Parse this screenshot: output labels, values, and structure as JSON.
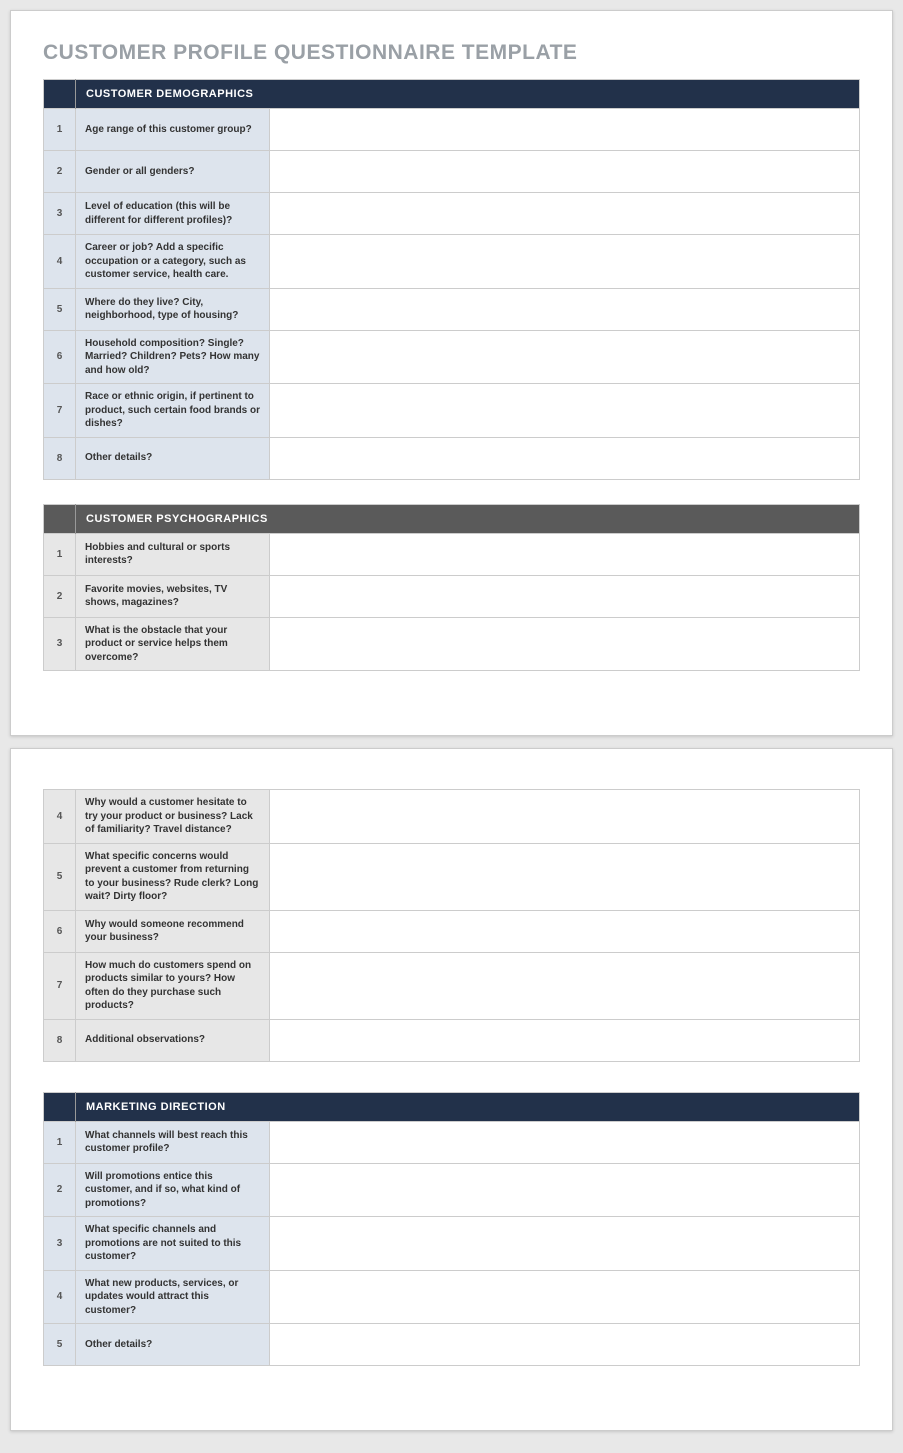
{
  "title": "CUSTOMER PROFILE QUESTIONNAIRE TEMPLATE",
  "sections": {
    "demographics": {
      "header": "CUSTOMER DEMOGRAPHICS",
      "rows": [
        {
          "num": "1",
          "text": "Age range of this customer group?"
        },
        {
          "num": "2",
          "text": "Gender or all genders?"
        },
        {
          "num": "3",
          "text": "Level of education (this will be different for different profiles)?"
        },
        {
          "num": "4",
          "text": "Career or job? Add a specific occupation or a category, such as customer service, health care."
        },
        {
          "num": "5",
          "text": "Where do they live? City, neighborhood, type of housing?"
        },
        {
          "num": "6",
          "text": "Household composition? Single? Married? Children? Pets? How many and how old?"
        },
        {
          "num": "7",
          "text": "Race or ethnic origin, if pertinent to product, such certain food brands or dishes?"
        },
        {
          "num": "8",
          "text": "Other details?"
        }
      ]
    },
    "psychographics": {
      "header": "CUSTOMER PSYCHOGRAPHICS",
      "rows_p1": [
        {
          "num": "1",
          "text": "Hobbies and cultural or sports interests?"
        },
        {
          "num": "2",
          "text": "Favorite movies, websites, TV shows, magazines?"
        },
        {
          "num": "3",
          "text": "What is the obstacle that your product or service helps them overcome?"
        }
      ],
      "rows_p2": [
        {
          "num": "4",
          "text": "Why would a customer hesitate to try your product or business? Lack of familiarity? Travel distance?"
        },
        {
          "num": "5",
          "text": "What specific concerns would prevent a customer from returning to your business? Rude clerk? Long wait? Dirty floor?"
        },
        {
          "num": "6",
          "text": "Why would someone recommend your business?"
        },
        {
          "num": "7",
          "text": "How much do customers spend on products similar to yours? How often do they purchase such products?"
        },
        {
          "num": "8",
          "text": "Additional observations?"
        }
      ]
    },
    "marketing": {
      "header": "MARKETING DIRECTION",
      "rows": [
        {
          "num": "1",
          "text": "What channels will best reach this customer profile?"
        },
        {
          "num": "2",
          "text": "Will promotions entice this customer, and if so, what kind of promotions?"
        },
        {
          "num": "3",
          "text": "What specific channels and promotions are not suited to this customer?"
        },
        {
          "num": "4",
          "text": "What new products, services, or updates would attract this customer?"
        },
        {
          "num": "5",
          "text": "Other details?"
        }
      ]
    }
  }
}
